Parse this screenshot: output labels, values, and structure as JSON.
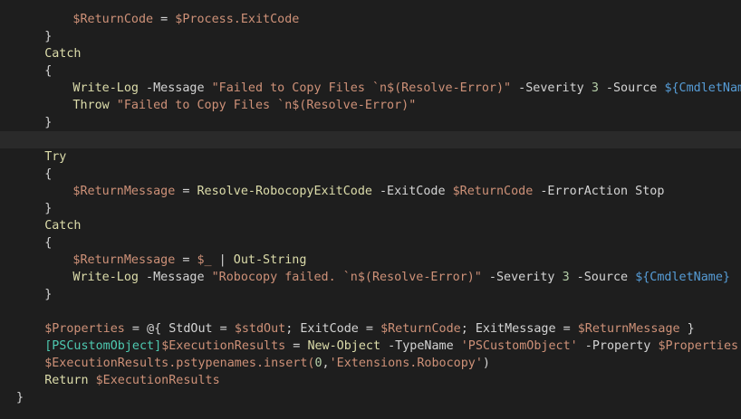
{
  "editor": {
    "colors": {
      "background": "#1e1e1e",
      "current_line": "#2a2a2a",
      "keyword": "#dcdcaa",
      "variable": "#ce9178",
      "string": "#ce9178",
      "parameter": "#d4d4d4",
      "plain": "#d4d4d4",
      "type": "#4ec9b0",
      "number": "#b5cea8",
      "special_var": "#569cd6"
    },
    "current_line_index": 7,
    "lines": [
      {
        "indent": 8,
        "tokens": [
          {
            "t": "$ReturnCode",
            "c": "#ce9178"
          },
          {
            "t": " = ",
            "c": "#d4d4d4"
          },
          {
            "t": "$Process.ExitCode",
            "c": "#ce9178"
          }
        ]
      },
      {
        "indent": 4,
        "tokens": [
          {
            "t": "}",
            "c": "#d4d4d4"
          }
        ]
      },
      {
        "indent": 4,
        "tokens": [
          {
            "t": "Catch",
            "c": "#dcdcaa"
          }
        ]
      },
      {
        "indent": 4,
        "tokens": [
          {
            "t": "{",
            "c": "#d4d4d4"
          }
        ]
      },
      {
        "indent": 8,
        "tokens": [
          {
            "t": "Write-Log",
            "c": "#dcdcaa"
          },
          {
            "t": " -Message ",
            "c": "#d4d4d4"
          },
          {
            "t": "\"Failed to Copy Files `n$(Resolve-Error)\"",
            "c": "#ce9178"
          },
          {
            "t": " -Severity ",
            "c": "#d4d4d4"
          },
          {
            "t": "3",
            "c": "#b5cea8"
          },
          {
            "t": " -Source ",
            "c": "#d4d4d4"
          },
          {
            "t": "${CmdletName}",
            "c": "#569cd6"
          }
        ]
      },
      {
        "indent": 8,
        "tokens": [
          {
            "t": "Throw",
            "c": "#dcdcaa"
          },
          {
            "t": " ",
            "c": "#d4d4d4"
          },
          {
            "t": "\"Failed to Copy Files `n$(Resolve-Error)\"",
            "c": "#ce9178"
          }
        ]
      },
      {
        "indent": 4,
        "tokens": [
          {
            "t": "}",
            "c": "#d4d4d4"
          }
        ]
      },
      {
        "indent": 0,
        "tokens": []
      },
      {
        "indent": 4,
        "tokens": [
          {
            "t": "Try",
            "c": "#dcdcaa"
          }
        ]
      },
      {
        "indent": 4,
        "tokens": [
          {
            "t": "{",
            "c": "#d4d4d4"
          }
        ]
      },
      {
        "indent": 8,
        "tokens": [
          {
            "t": "$ReturnMessage",
            "c": "#ce9178"
          },
          {
            "t": " = ",
            "c": "#d4d4d4"
          },
          {
            "t": "Resolve-RobocopyExitCode",
            "c": "#dcdcaa"
          },
          {
            "t": " -ExitCode ",
            "c": "#d4d4d4"
          },
          {
            "t": "$ReturnCode",
            "c": "#ce9178"
          },
          {
            "t": " -ErrorAction Stop",
            "c": "#d4d4d4"
          }
        ]
      },
      {
        "indent": 4,
        "tokens": [
          {
            "t": "}",
            "c": "#d4d4d4"
          }
        ]
      },
      {
        "indent": 4,
        "tokens": [
          {
            "t": "Catch",
            "c": "#dcdcaa"
          }
        ]
      },
      {
        "indent": 4,
        "tokens": [
          {
            "t": "{",
            "c": "#d4d4d4"
          }
        ]
      },
      {
        "indent": 8,
        "tokens": [
          {
            "t": "$ReturnMessage",
            "c": "#ce9178"
          },
          {
            "t": " = ",
            "c": "#d4d4d4"
          },
          {
            "t": "$_",
            "c": "#ce9178"
          },
          {
            "t": " | ",
            "c": "#d4d4d4"
          },
          {
            "t": "Out-String",
            "c": "#dcdcaa"
          }
        ]
      },
      {
        "indent": 8,
        "tokens": [
          {
            "t": "Write-Log",
            "c": "#dcdcaa"
          },
          {
            "t": " -Message ",
            "c": "#d4d4d4"
          },
          {
            "t": "\"Robocopy failed. `n$(Resolve-Error)\"",
            "c": "#ce9178"
          },
          {
            "t": " -Severity ",
            "c": "#d4d4d4"
          },
          {
            "t": "3",
            "c": "#b5cea8"
          },
          {
            "t": " -Source ",
            "c": "#d4d4d4"
          },
          {
            "t": "${CmdletName}",
            "c": "#569cd6"
          }
        ]
      },
      {
        "indent": 4,
        "tokens": [
          {
            "t": "}",
            "c": "#d4d4d4"
          }
        ]
      },
      {
        "indent": 0,
        "tokens": []
      },
      {
        "indent": 4,
        "tokens": [
          {
            "t": "$Properties",
            "c": "#ce9178"
          },
          {
            "t": " = @{ StdOut = ",
            "c": "#d4d4d4"
          },
          {
            "t": "$stdOut",
            "c": "#ce9178"
          },
          {
            "t": "; ExitCode = ",
            "c": "#d4d4d4"
          },
          {
            "t": "$ReturnCode",
            "c": "#ce9178"
          },
          {
            "t": "; ExitMessage = ",
            "c": "#d4d4d4"
          },
          {
            "t": "$ReturnMessage",
            "c": "#ce9178"
          },
          {
            "t": " }",
            "c": "#d4d4d4"
          }
        ]
      },
      {
        "indent": 4,
        "tokens": [
          {
            "t": "[PSCustomObject]",
            "c": "#4ec9b0"
          },
          {
            "t": "$ExecutionResults",
            "c": "#ce9178"
          },
          {
            "t": " = ",
            "c": "#d4d4d4"
          },
          {
            "t": "New-Object",
            "c": "#dcdcaa"
          },
          {
            "t": " -TypeName ",
            "c": "#d4d4d4"
          },
          {
            "t": "'PSCustomObject'",
            "c": "#ce9178"
          },
          {
            "t": " -Property ",
            "c": "#d4d4d4"
          },
          {
            "t": "$Properties",
            "c": "#ce9178"
          }
        ]
      },
      {
        "indent": 4,
        "tokens": [
          {
            "t": "$ExecutionResults.pstypenames.insert(",
            "c": "#ce9178"
          },
          {
            "t": "0",
            "c": "#b5cea8"
          },
          {
            "t": ",",
            "c": "#d4d4d4"
          },
          {
            "t": "'Extensions.Robocopy'",
            "c": "#ce9178"
          },
          {
            "t": ")",
            "c": "#d4d4d4"
          }
        ]
      },
      {
        "indent": 4,
        "tokens": [
          {
            "t": "Return",
            "c": "#dcdcaa"
          },
          {
            "t": " ",
            "c": "#d4d4d4"
          },
          {
            "t": "$ExecutionResults",
            "c": "#ce9178"
          }
        ]
      },
      {
        "indent": 0,
        "tokens": [
          {
            "t": "}",
            "c": "#d4d4d4"
          }
        ]
      }
    ]
  }
}
